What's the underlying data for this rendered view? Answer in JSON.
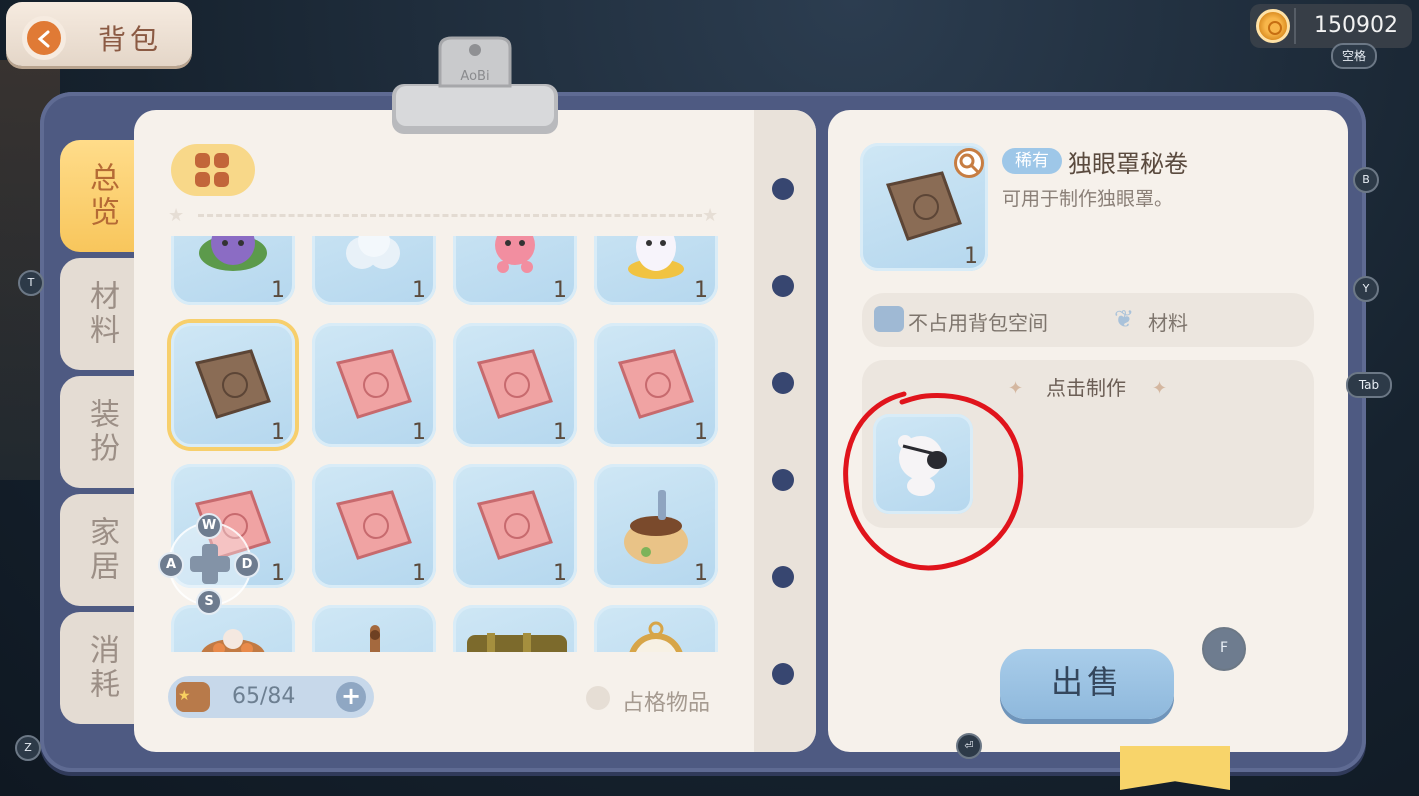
{
  "header": {
    "title": "背包",
    "currency_value": "150902",
    "space_key": "空格"
  },
  "tabs": [
    {
      "label": "总览",
      "active": true
    },
    {
      "label": "材料",
      "active": false
    },
    {
      "label": "装扮",
      "active": false
    },
    {
      "label": "家居",
      "active": false
    },
    {
      "label": "消耗",
      "active": false
    }
  ],
  "keys": {
    "t": "T",
    "z": "Z",
    "b": "B",
    "y": "Y",
    "tab": "Tab",
    "f": "F",
    "enter": "⏎",
    "w": "W",
    "a": "A",
    "s": "S",
    "d": "D"
  },
  "inventory": {
    "items": [
      {
        "icon": "purple-flower-creature",
        "count": "1"
      },
      {
        "icon": "cotton-cloud",
        "count": "1"
      },
      {
        "icon": "pink-octopus",
        "count": "1"
      },
      {
        "icon": "white-ghost-cushion",
        "count": "1"
      },
      {
        "icon": "brown-scroll",
        "count": "1",
        "selected": true
      },
      {
        "icon": "pink-scroll",
        "count": "1"
      },
      {
        "icon": "pink-scroll",
        "count": "1"
      },
      {
        "icon": "pink-scroll",
        "count": "1"
      },
      {
        "icon": "pink-scroll",
        "count": "1"
      },
      {
        "icon": "pink-scroll",
        "count": "1"
      },
      {
        "icon": "pink-scroll",
        "count": "1"
      },
      {
        "icon": "dirt-sack-with-shovel",
        "count": "1"
      },
      {
        "icon": "flower-food-bowl",
        "count": ""
      },
      {
        "icon": "wooden-paddle",
        "count": ""
      },
      {
        "icon": "bronze-telescope",
        "count": ""
      },
      {
        "icon": "pocket-watch",
        "count": ""
      }
    ],
    "capacity": "65/84",
    "occupy_label": "占格物品"
  },
  "detail": {
    "rarity": "稀有",
    "name": "独眼罩秘卷",
    "description": "可用于制作独眼罩。",
    "count": "1",
    "prop_space": "不占用背包空间",
    "prop_type": "材料",
    "craft_title": "点击制作",
    "craft_result_icon": "bear-eyepatch",
    "sell_label": "出售"
  },
  "clip_brand": "AoBi",
  "colors": {
    "accent_tab": "#f8c65c",
    "board": "#4e5a82",
    "cell": "#b5d7ee",
    "annotation_red": "#e0141c"
  }
}
